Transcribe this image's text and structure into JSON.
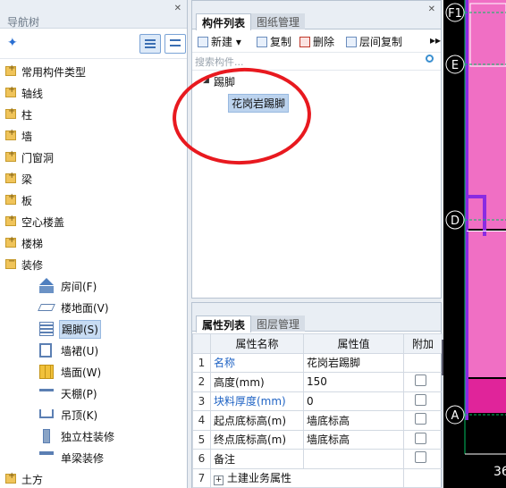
{
  "nav": {
    "title": "导航树",
    "top_items": [
      "常用构件类型",
      "轴线",
      "柱",
      "墙",
      "门窗洞",
      "梁",
      "板",
      "空心楼盖",
      "楼梯"
    ],
    "open_item": "装修",
    "children": [
      {
        "label": "房间(F)",
        "icon": "room-icon"
      },
      {
        "label": "楼地面(V)",
        "icon": "floor-icon"
      },
      {
        "label": "踢脚(S)",
        "icon": "skirting-icon",
        "selected": true
      },
      {
        "label": "墙裙(U)",
        "icon": "dado-icon"
      },
      {
        "label": "墙面(W)",
        "icon": "wall-face-icon"
      },
      {
        "label": "天棚(P)",
        "icon": "ceiling-icon"
      },
      {
        "label": "吊顶(K)",
        "icon": "suspended-ceiling-icon"
      },
      {
        "label": "独立柱装修",
        "icon": "column-finish-icon"
      },
      {
        "label": "单梁装修",
        "icon": "beam-finish-icon"
      }
    ],
    "bottom_item": "土方"
  },
  "component_panel": {
    "tabs": [
      "构件列表",
      "图纸管理"
    ],
    "toolbar": {
      "new": "新建",
      "copy": "复制",
      "delete": "删除",
      "floor_copy": "层间复制",
      "more": "▸▸"
    },
    "search_placeholder": "搜索构件...",
    "group": "踢脚",
    "item": "花岗岩踢脚"
  },
  "property_panel": {
    "tabs": [
      "属性列表",
      "图层管理"
    ],
    "columns": [
      "属性名称",
      "属性值",
      "附加"
    ],
    "rows": [
      {
        "num": "1",
        "name": "名称",
        "value": "花岗岩踢脚",
        "blue": true,
        "checkbox": false
      },
      {
        "num": "2",
        "name": "高度(mm)",
        "value": "150",
        "blue": false,
        "checkbox": true
      },
      {
        "num": "3",
        "name": "块料厚度(mm)",
        "value": "0",
        "blue": true,
        "checkbox": true
      },
      {
        "num": "4",
        "name": "起点底标高(m)",
        "value": "墙底标高",
        "blue": false,
        "checkbox": true
      },
      {
        "num": "5",
        "name": "终点底标高(m)",
        "value": "墙底标高",
        "blue": false,
        "checkbox": true
      },
      {
        "num": "6",
        "name": "备注",
        "value": "",
        "blue": false,
        "checkbox": true
      },
      {
        "num": "7",
        "name": "土建业务属性",
        "value": "",
        "blue": false,
        "checkbox": false,
        "expand": true
      }
    ]
  },
  "drawing": {
    "axes": [
      "F1",
      "E",
      "D",
      "A"
    ],
    "dimension": "36",
    "colors": {
      "fill": "#f06fc4",
      "dark_fill": "#e0249a",
      "wall": "#8a2be2",
      "grid": "#00c060",
      "bg": "#000000"
    }
  }
}
